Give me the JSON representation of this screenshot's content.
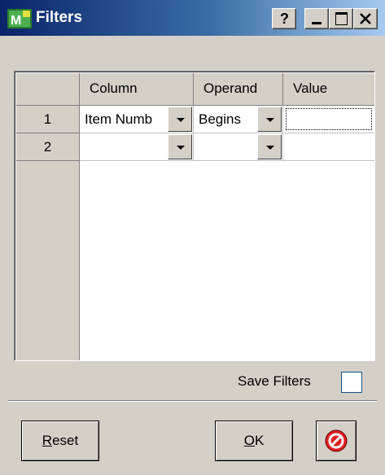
{
  "window": {
    "title": "Filters",
    "help_label": "?"
  },
  "grid": {
    "headers": {
      "column": "Column",
      "operand": "Operand",
      "value": "Value"
    },
    "rows": [
      {
        "num": "1",
        "column": "Item Numb",
        "operand": "Begins",
        "value": ""
      },
      {
        "num": "2",
        "column": "",
        "operand": "",
        "value": ""
      }
    ]
  },
  "save_filters": {
    "label": "Save Filters",
    "checked": false
  },
  "buttons": {
    "reset": {
      "mnemonic": "R",
      "rest": "eset"
    },
    "ok": {
      "mnemonic": "O",
      "rest": "K"
    },
    "cancel_icon": "no-entry-icon"
  },
  "colors": {
    "title_start": "#0a246a",
    "title_end": "#a6caf0",
    "cancel_red": "#e02020",
    "face": "#d4d0c8"
  }
}
